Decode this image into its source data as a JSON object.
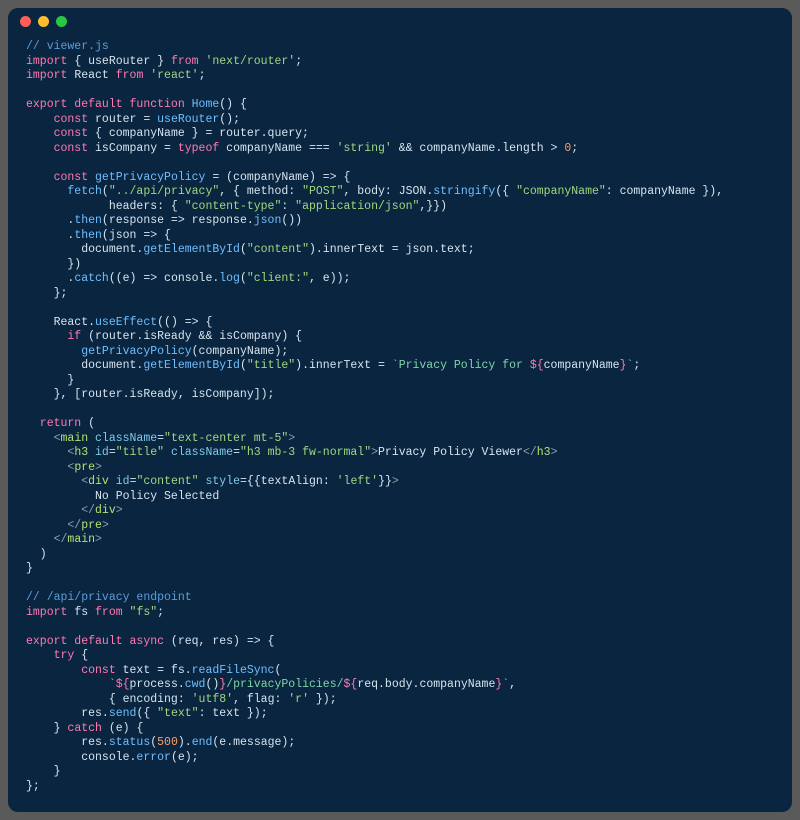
{
  "window": {
    "buttons": [
      "close",
      "minimize",
      "zoom"
    ]
  },
  "code": {
    "l1": "// viewer.js",
    "l2a": "import",
    "l2b": " { useRouter } ",
    "l2c": "from",
    "l2d": " 'next/router'",
    "l2e": ";",
    "l3a": "import",
    "l3b": " React ",
    "l3c": "from",
    "l3d": " 'react'",
    "l3e": ";",
    "l5a": "export default function",
    "l5b": " Home",
    "l5c": "() {",
    "l6a": "    const",
    "l6b": " router = ",
    "l6c": "useRouter",
    "l6d": "();",
    "l7a": "    const",
    "l7b": " { companyName } = router.query;",
    "l8a": "    const",
    "l8b": " isCompany = ",
    "l8c": "typeof",
    "l8d": " companyName === ",
    "l8e": "'string'",
    "l8f": " && companyName.length > ",
    "l8g": "0",
    "l8h": ";",
    "l10a": "    const",
    "l10b": " getPrivacyPolicy",
    "l10c": " = (companyName) => {",
    "l11a": "      fetch",
    "l11b": "(",
    "l11c": "\"../api/privacy\"",
    "l11d": ", { method: ",
    "l11e": "\"POST\"",
    "l11f": ", body: JSON.",
    "l11g": "stringify",
    "l11h": "({ ",
    "l11i": "\"companyName\"",
    "l11j": ": companyName }),",
    "l12a": "            headers: { ",
    "l12b": "\"content-type\"",
    "l12c": ": ",
    "l12d": "\"application/json\"",
    "l12e": ",}})",
    "l13a": "      .",
    "l13b": "then",
    "l13c": "(response => response.",
    "l13d": "json",
    "l13e": "())",
    "l14a": "      .",
    "l14b": "then",
    "l14c": "(json => {",
    "l15a": "        document.",
    "l15b": "getElementById",
    "l15c": "(",
    "l15d": "\"content\"",
    "l15e": ").innerText = json.text;",
    "l16": "      })",
    "l17a": "      .",
    "l17b": "catch",
    "l17c": "((e) => console.",
    "l17d": "log",
    "l17e": "(",
    "l17f": "\"client:\"",
    "l17g": ", e));",
    "l18": "    };",
    "l20a": "    React.",
    "l20b": "useEffect",
    "l20c": "(() => {",
    "l21a": "      if",
    "l21b": " (router.isReady && isCompany) {",
    "l22a": "        getPrivacyPolicy",
    "l22b": "(companyName);",
    "l23a": "        document.",
    "l23b": "getElementById",
    "l23c": "(",
    "l23d": "\"title\"",
    "l23e": ").innerText = ",
    "l23f": "`Privacy Policy for ",
    "l23g": "${",
    "l23h": "companyName",
    "l23i": "}",
    "l23j": "`",
    "l23k": ";",
    "l24": "      }",
    "l25": "    }, [router.isReady, isCompany]);",
    "l27a": "  return",
    "l27b": " (",
    "l28a": "    <",
    "l28b": "main",
    "l28c": " className",
    "l28d": "=",
    "l28e": "\"text-center mt-5\"",
    "l28f": ">",
    "l29a": "      <",
    "l29b": "h3",
    "l29c": " id",
    "l29d": "=",
    "l29e": "\"title\"",
    "l29f": " className",
    "l29g": "=",
    "l29h": "\"h3 mb-3 fw-normal\"",
    "l29i": ">",
    "l29j": "Privacy Policy Viewer",
    "l29k": "</",
    "l29l": "h3",
    "l29m": ">",
    "l30a": "      <",
    "l30b": "pre",
    "l30c": ">",
    "l31a": "        <",
    "l31b": "div",
    "l31c": " id",
    "l31d": "=",
    "l31e": "\"content\"",
    "l31f": " style",
    "l31g": "=",
    "l31h": "{{textAlign: ",
    "l31i": "'left'",
    "l31j": "}}",
    "l31k": ">",
    "l32": "          No Policy Selected",
    "l33a": "        </",
    "l33b": "div",
    "l33c": ">",
    "l34a": "      </",
    "l34b": "pre",
    "l34c": ">",
    "l35a": "    </",
    "l35b": "main",
    "l35c": ">",
    "l36": "  )",
    "l37": "}",
    "l39": "// /api/privacy endpoint",
    "l40a": "import",
    "l40b": " fs ",
    "l40c": "from",
    "l40d": " \"fs\"",
    "l40e": ";",
    "l42a": "export default async",
    "l42b": " (req, res) => {",
    "l43a": "    try",
    "l43b": " {",
    "l44a": "        const",
    "l44b": " text = fs.",
    "l44c": "readFileSync",
    "l44d": "(",
    "l45a": "            `",
    "l45b": "${",
    "l45c": "process.",
    "l45d": "cwd",
    "l45e": "()",
    "l45f": "}",
    "l45g": "/privacyPolicies/",
    "l45h": "${",
    "l45i": "req.body.companyName",
    "l45j": "}",
    "l45k": "`",
    "l45l": ",",
    "l46a": "            { encoding: ",
    "l46b": "'utf8'",
    "l46c": ", flag: ",
    "l46d": "'r'",
    "l46e": " });",
    "l47a": "        res.",
    "l47b": "send",
    "l47c": "({ ",
    "l47d": "\"text\"",
    "l47e": ": text });",
    "l48a": "    } ",
    "l48b": "catch",
    "l48c": " (e) {",
    "l49a": "        res.",
    "l49b": "status",
    "l49c": "(",
    "l49d": "500",
    "l49e": ").",
    "l49f": "end",
    "l49g": "(e.message);",
    "l50a": "        console.",
    "l50b": "error",
    "l50c": "(e);",
    "l51": "    }",
    "l52": "};"
  }
}
